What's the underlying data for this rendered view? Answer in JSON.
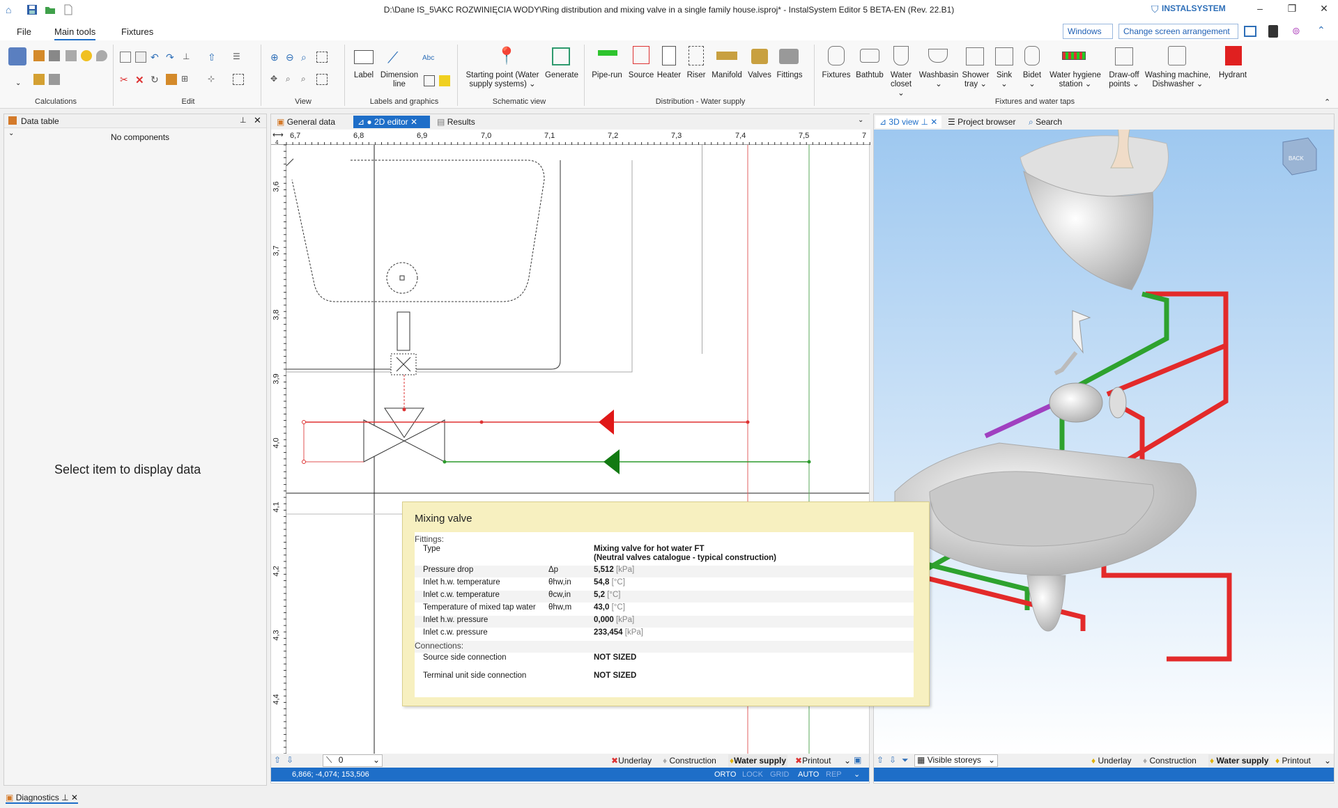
{
  "window": {
    "title": "D:\\Dane IS_5\\AKC ROZWINIĘCIA WODY\\Ring distribution and mixing valve in a single family house.isproj* - InstalSystem Editor 5 BETA-EN (Rev. 22.B1)",
    "brand": "INSTALSYSTEM",
    "controls": {
      "minimize": "–",
      "restore": "❐",
      "close": "✕"
    }
  },
  "menu": {
    "tabs": [
      "File",
      "Main tools",
      "Fixtures"
    ],
    "active": "Main tools",
    "windows_dropdown": "Windows",
    "arrangement_dropdown": "Change screen arrangement"
  },
  "ribbon": {
    "groups": {
      "calculations": "Calculations",
      "edit": "Edit",
      "view": "View",
      "labels": "Labels and graphics",
      "schematic": "Schematic view",
      "distribution": "Distribution - Water supply",
      "fixtures": "Fixtures and water taps"
    },
    "labels_group": {
      "label": "Label",
      "dimension1": "Dimension",
      "dimension2": "line"
    },
    "schematic": {
      "start1": "Starting point (Water",
      "start2": "supply systems)",
      "generate": "Generate"
    },
    "distribution": [
      "Pipe-run",
      "Source",
      "Heater",
      "Riser",
      "Manifold",
      "Valves",
      "Fittings"
    ],
    "fixtures": [
      {
        "l1": "Fixtures",
        "l2": ""
      },
      {
        "l1": "Bathtub",
        "l2": ""
      },
      {
        "l1": "Water",
        "l2": "closet"
      },
      {
        "l1": "Washbasin",
        "l2": ""
      },
      {
        "l1": "Shower",
        "l2": "tray"
      },
      {
        "l1": "Sink",
        "l2": ""
      },
      {
        "l1": "Bidet",
        "l2": ""
      },
      {
        "l1": "Water hygiene",
        "l2": "station"
      },
      {
        "l1": "Draw-off",
        "l2": "points"
      },
      {
        "l1": "Washing machine,",
        "l2": "Dishwasher"
      },
      {
        "l1": "Hydrant",
        "l2": ""
      }
    ],
    "abc": "Abc"
  },
  "left_panel": {
    "title": "Data table",
    "no_components": "No components",
    "placeholder": "Select item to display data"
  },
  "editor": {
    "tabs": {
      "general": "General data",
      "editor2d": "● 2D editor",
      "results": "Results"
    },
    "ruler_top": [
      "6,7",
      "6,8",
      "6,9",
      "7,0",
      "7,1",
      "7,2",
      "7,3",
      "7,4",
      "7,5",
      "7"
    ],
    "ruler_left": [
      "3,6",
      "3,7",
      "3,8",
      "3,9",
      "4,0",
      "4,1",
      "4,2",
      "4,3",
      "4,4"
    ],
    "ruler_corner": "4",
    "layer_value": "0",
    "bottom_items": [
      "Underlay",
      "Construction",
      "Water supply",
      "Printout"
    ],
    "status": {
      "coords": "6,866; -4,074; 153,506",
      "flags": [
        "ORTO",
        "LOCK",
        "GRID",
        "AUTO",
        "REP"
      ]
    }
  },
  "tooltip": {
    "title": "Mixing valve",
    "sections": {
      "fittings": "Fittings:",
      "connections": "Connections:"
    },
    "rows": [
      {
        "name": "Type",
        "symbol": "",
        "value": "Mixing valve for hot water FT",
        "value2": "(Neutral valves catalogue - typical construction)",
        "unit": ""
      },
      {
        "name": "Pressure drop",
        "symbol": "Δp",
        "value": "5,512",
        "unit": "[kPa]"
      },
      {
        "name": "Inlet h.w. temperature",
        "symbol": "θhw,in",
        "value": "54,8",
        "unit": "[°C]"
      },
      {
        "name": "Inlet c.w. temperature",
        "symbol": "θcw,in",
        "value": "5,2",
        "unit": "[°C]"
      },
      {
        "name": "Temperature of mixed tap water",
        "symbol": "θhw,m",
        "value": "43,0",
        "unit": "[°C]"
      },
      {
        "name": "Inlet h.w. pressure",
        "symbol": "",
        "value": "0,000",
        "unit": "[kPa]"
      },
      {
        "name": "Inlet c.w. pressure",
        "symbol": "",
        "value": "233,454",
        "unit": "[kPa]"
      }
    ],
    "connections": [
      {
        "name": "Source side connection",
        "value": "NOT SIZED"
      },
      {
        "name": "Terminal unit side connection",
        "value": "NOT SIZED"
      }
    ]
  },
  "view3d": {
    "tabs": {
      "view": "3D view",
      "browser": "Project browser",
      "search": "Search"
    },
    "cube_label": "BACK",
    "storeys": "Visible storeys",
    "bottom_items": [
      "Underlay",
      "Construction",
      "Water supply",
      "Printout"
    ]
  },
  "diagnostics": {
    "title": "Diagnostics"
  },
  "colors": {
    "accent": "#1e6ec8",
    "hot": "#e52b2b",
    "cold": "#2e9a2e",
    "circ": "#a040c0",
    "tooltip": "#f7f0c0"
  }
}
